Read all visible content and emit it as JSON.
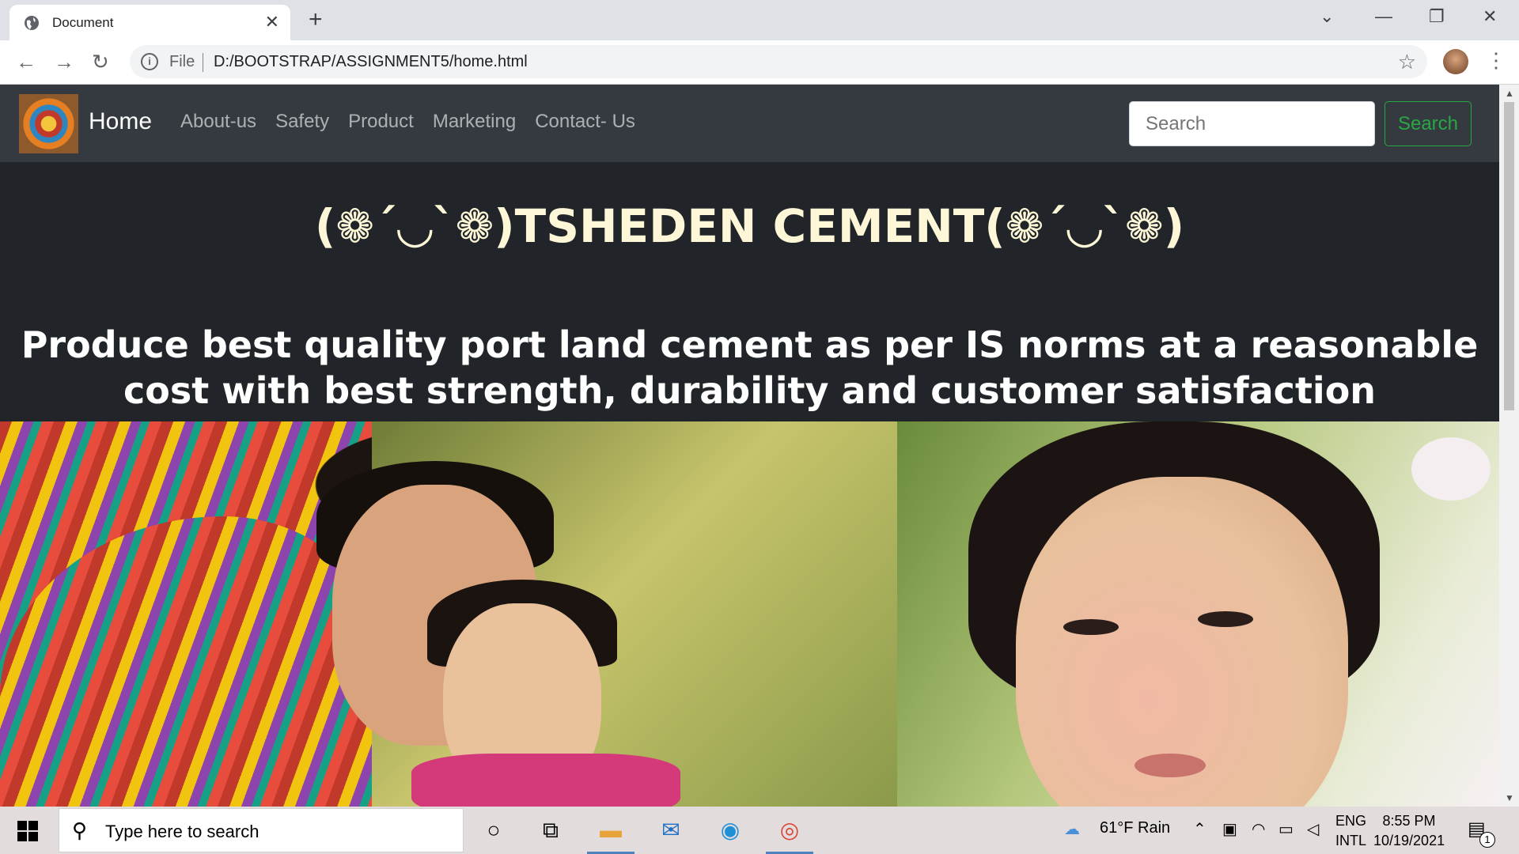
{
  "browser": {
    "tab_title": "Document",
    "tab_close": "✕",
    "new_tab": "+",
    "url_scheme_label": "File",
    "url": "D:/BOOTSTRAP/ASSIGNMENT5/home.html",
    "back": "←",
    "forward": "→",
    "reload": "↻",
    "star": "☆",
    "menu": "⋮",
    "controls": {
      "dropdown": "⌄",
      "minimize": "—",
      "restore": "❐",
      "close": "✕"
    }
  },
  "navbar": {
    "brand": "Home",
    "links": [
      "About-us",
      "Safety",
      "Product",
      "Marketing",
      "Contact- Us"
    ],
    "search_placeholder": "Search",
    "search_button": "Search"
  },
  "hero": {
    "title": "(❁´◡`❁)TSHEDEN CEMENT(❁´◡`❁)",
    "subtitle": "Produce best quality port land cement as per IS norms at a reasonable cost with best strength, durability and customer satisfaction"
  },
  "taskbar": {
    "search_placeholder": "Type here to search",
    "weather": "61°F  Rain",
    "lang_top": "ENG",
    "lang_bottom": "INTL",
    "time": "8:55 PM",
    "date": "10/19/2021",
    "notification_count": "1"
  },
  "colors": {
    "navbar_bg": "#343a40",
    "page_bg": "#212529",
    "title_color": "#fdf7d7",
    "search_button": "#28a745"
  }
}
